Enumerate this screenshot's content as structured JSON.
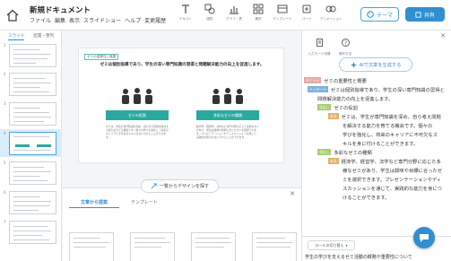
{
  "app": {
    "document_title": "新規ドキュメント",
    "menu": [
      "ファイル",
      "編集",
      "表示",
      "スライドショー",
      "ヘルプ",
      "変更履歴"
    ],
    "tools": [
      {
        "label": "テキスト",
        "icon": "text-icon"
      },
      {
        "label": "図形",
        "icon": "shape-icon"
      },
      {
        "label": "グラフ・表",
        "icon": "chart-icon"
      },
      {
        "label": "素材",
        "icon": "assets-icon"
      },
      {
        "label": "テンプレート",
        "icon": "template-icon"
      },
      {
        "label": "パーツ",
        "icon": "parts-icon"
      },
      {
        "label": "アニメーション",
        "icon": "animation-icon"
      }
    ],
    "theme_button": "テーマ",
    "share_button": "共有",
    "accent_color": "#2f8fd0",
    "slide_accent": "#2ba99f"
  },
  "left_panel": {
    "tabs": [
      "スライド",
      "配置・整列"
    ],
    "slide_numbers": [
      "1",
      "2",
      "3",
      "4",
      "5",
      "6",
      "7"
    ],
    "active_slide": 5
  },
  "slide": {
    "label": "ゼミの重要性と概要",
    "title": "ゼミは個別指導であり、学生の深い専門知識の習得と問題解決能力の向上を促進します。",
    "left_banner": "ゼミの役割",
    "right_banner": "多彩なゼミの種類",
    "left_body": "ゼミは、学生が専門知識を深め、自ら考え問題を解決する能力を育てる機会です。個々の学びを強化し、将来のキャリアに不可欠なスキルを身に付けることができます。",
    "right_body": "経済学、経営学、法学など専門分野に応じた多様なゼミがあり、学生は興味や目標に合ったゼミを選択できます。プレゼンテーションやディスカッションを通じて、実践的な能力を身につけることができます。"
  },
  "design_button": "一覧からデザインを探す",
  "bottom_panel": {
    "tabs": [
      "文章から提案",
      "テンプレート"
    ],
    "active_tab": 0
  },
  "right_panel": {
    "icon_labels": [
      "入力モード切替",
      "操作方法"
    ],
    "ai_button": "AIで文章を生成する",
    "outline": [
      {
        "tag": "タイトル",
        "type": "title",
        "text": "ゼミの重要性と概要"
      },
      {
        "tag": "メッセージ",
        "type": "message",
        "text": "ゼミは個別指導であり、学生の深い専門知識の習得と"
      },
      {
        "tag": "",
        "type": "",
        "text": "問題解決能力の向上を促進します。"
      },
      {
        "tag": "見出し",
        "type": "heading",
        "text": "ゼミの役割"
      },
      {
        "tag": "本文",
        "type": "body",
        "text": "ゼミは、学生が専門知識を深め、自ら考え問題"
      },
      {
        "tag": "",
        "type": "",
        "text": "を解決する能力を育てる機会です。個々の"
      },
      {
        "tag": "",
        "type": "",
        "text": "学びを強化し、将来のキャリアに不可欠なス"
      },
      {
        "tag": "",
        "type": "",
        "text": "キルを身に付けることができます。"
      },
      {
        "tag": "見出し",
        "type": "heading",
        "text": "多彩なゼミの種類"
      },
      {
        "tag": "本文",
        "type": "body",
        "text": "経済学、経営学、法学など専門分野に応じた多"
      },
      {
        "tag": "",
        "type": "",
        "text": "様なゼミがあり、学生は興味や目標に合ったゼ"
      },
      {
        "tag": "",
        "type": "",
        "text": "ミを選択できます。プレゼンテーションやディ"
      },
      {
        "tag": "",
        "type": "",
        "text": "スカッションを通じて、実践的な能力を身につ"
      },
      {
        "tag": "",
        "type": "",
        "text": "けることができます。"
      }
    ],
    "role_button": "ロールの切り替え",
    "summary_text": "学生の学びを支えるゼミ活動の概略や重要性について"
  }
}
